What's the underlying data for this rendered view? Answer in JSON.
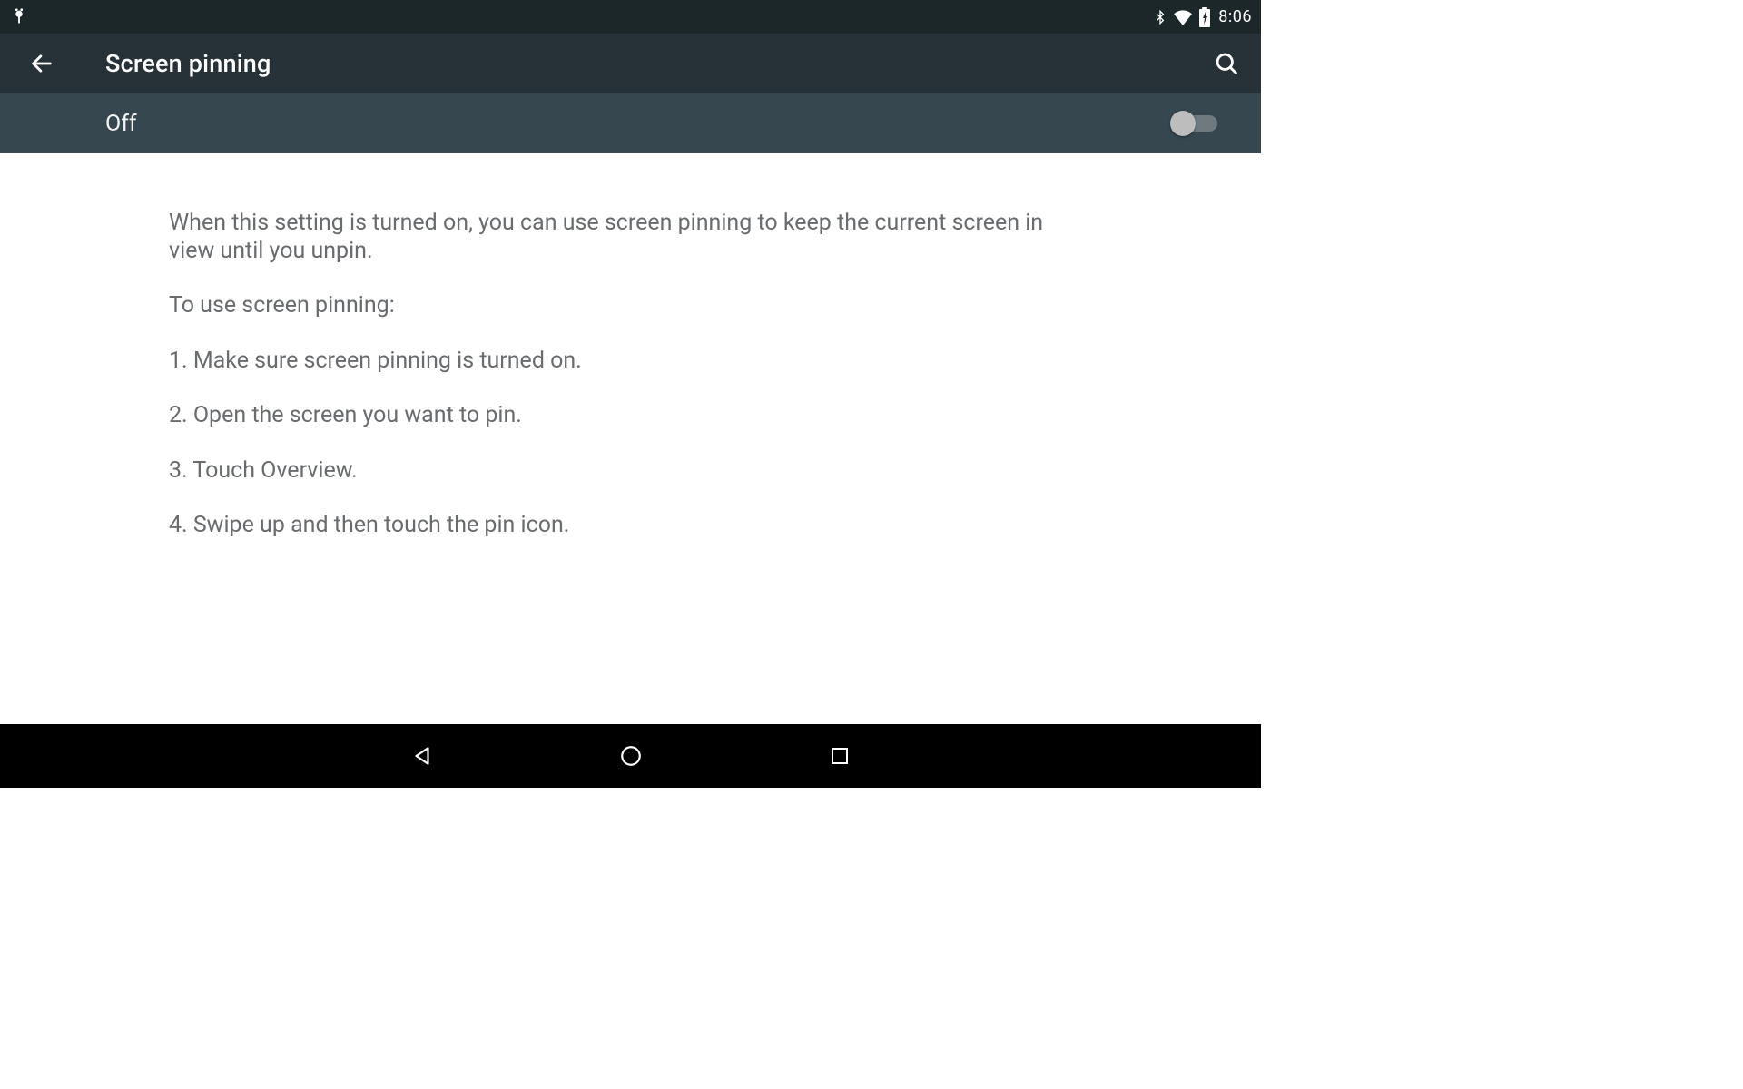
{
  "status": {
    "time": "8:06"
  },
  "header": {
    "title": "Screen pinning"
  },
  "toggle": {
    "state_label": "Off",
    "on": false
  },
  "description": {
    "intro": "When this setting is turned on, you can use screen pinning to keep the current screen in view until you unpin.",
    "howto_heading": "To use screen pinning:",
    "steps": [
      "1. Make sure screen pinning is turned on.",
      "2. Open the screen you want to pin.",
      "3. Touch Overview.",
      "4. Swipe up and then touch the pin icon."
    ]
  }
}
